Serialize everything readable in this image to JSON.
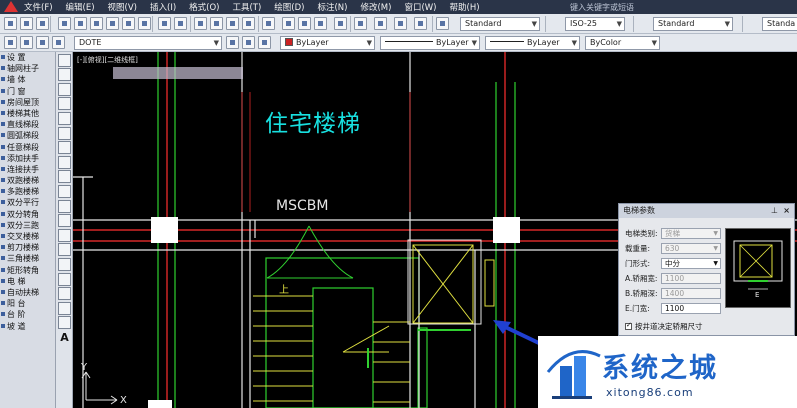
{
  "menu": [
    "文件(F)",
    "编辑(E)",
    "视图(V)",
    "插入(I)",
    "格式(O)",
    "工具(T)",
    "绘图(D)",
    "标注(N)",
    "修改(M)",
    "窗口(W)",
    "帮助(H)"
  ],
  "window_title": "键入关键字或短语",
  "toolbar": {
    "text_style": "Standard",
    "dim_style": "ISO-25",
    "table_style": "Standard",
    "multileader_style": "Standa",
    "layer": "DOTE",
    "color": "ByLayer",
    "linetype": "ByLayer",
    "lineweight": "ByLayer",
    "plot_style": "ByColor",
    "color_hex": "#cc2222"
  },
  "left_panel": [
    "设 置",
    "轴网柱子",
    "墙 体",
    "门 窗",
    "房间屋顶",
    "楼梯其他",
    "直线梯段",
    "圆弧梯段",
    "任意梯段",
    "添加扶手",
    "连接扶手",
    "双跑楼梯",
    "多跑楼梯",
    "双分平行",
    "双分转角",
    "双分三跑",
    "交叉楼梯",
    "剪刀楼梯",
    "三角楼梯",
    "矩形转角",
    "电 梯",
    "自动扶梯",
    "阳 台",
    "台 阶",
    "坡 道"
  ],
  "canvas": {
    "viewport_label": "[-][俯视][二维线框]",
    "title": "住宅楼梯",
    "label_mscbm": "MSCBM",
    "up_label": "上",
    "ucs_y": "Y",
    "ucs_x": "X"
  },
  "elevator_panel": {
    "title": "电梯参数",
    "rows": [
      {
        "label": "电梯类别:",
        "value": "货梯",
        "active": false
      },
      {
        "label": "载重量:",
        "value": "630",
        "active": false
      },
      {
        "label": "门形式:",
        "value": "中分",
        "active": true
      },
      {
        "label": "A.轿厢宽:",
        "value": "1100",
        "active": false
      },
      {
        "label": "B.轿厢深:",
        "value": "1400",
        "active": false
      },
      {
        "label": "E.门宽:",
        "value": "1100",
        "active": true
      }
    ],
    "checkbox": "按井道决定轿厢尺寸",
    "preview_label": "E"
  },
  "watermark": {
    "brand": "系统之城",
    "url": "xitong86.com"
  },
  "colors": {
    "wall": "#e6e6e6",
    "axis_red": "#ff3030",
    "green": "#30d030",
    "yellow": "#e0e040",
    "cyan": "#18e0e0",
    "blue_arrow": "#2040d0"
  }
}
